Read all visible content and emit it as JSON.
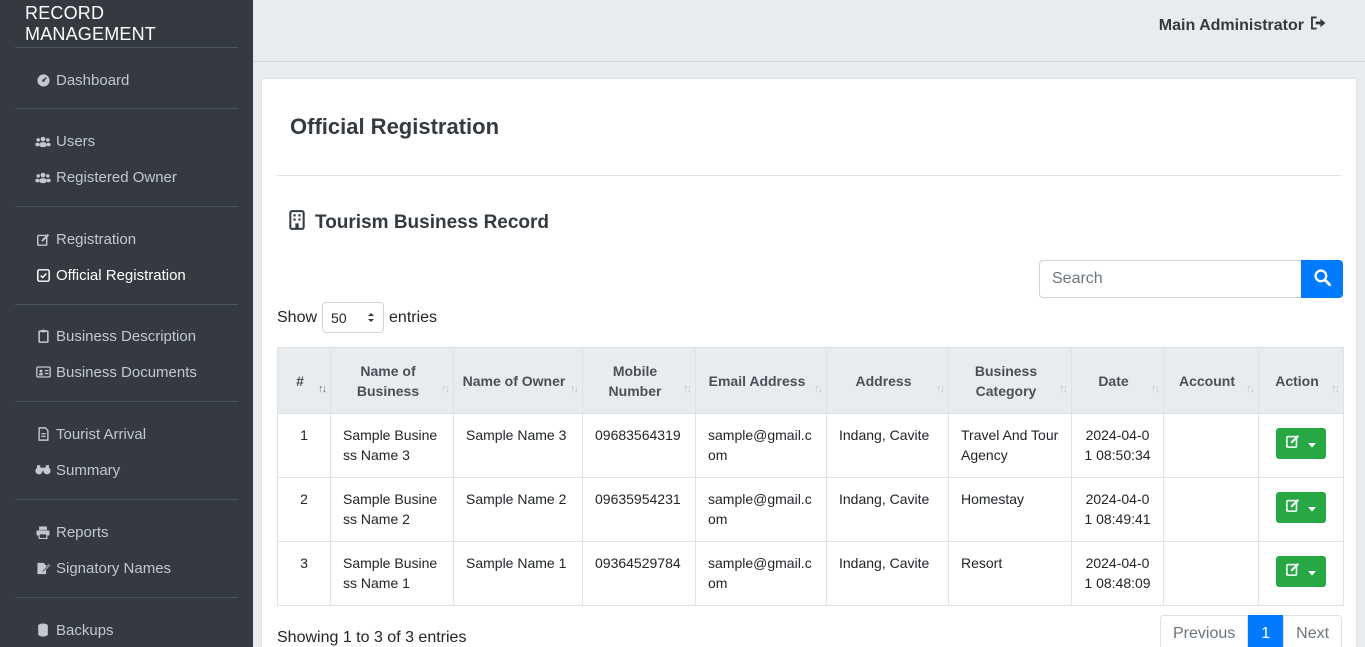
{
  "brand": "RECORD MANAGEMENT",
  "admin": {
    "name": "Main Administrator"
  },
  "nav": {
    "dashboard": "Dashboard",
    "users": "Users",
    "registered_owner": "Registered Owner",
    "registration": "Registration",
    "official_registration": "Official Registration",
    "business_description": "Business Description",
    "business_documents": "Business Documents",
    "tourist_arrival": "Tourist Arrival",
    "summary": "Summary",
    "reports": "Reports",
    "signatory_names": "Signatory Names",
    "backups": "Backups"
  },
  "page": {
    "title": "Official Registration",
    "section_title": "Tourism Business Record"
  },
  "search": {
    "placeholder": "Search"
  },
  "entries": {
    "show": "Show",
    "value": "50",
    "suffix": "entries"
  },
  "table": {
    "headers": {
      "num": "#",
      "business": "Name of Business",
      "owner": "Name of Owner",
      "mobile": "Mobile Number",
      "email": "Email Address",
      "address": "Address",
      "category": "Business Category",
      "date": "Date",
      "account": "Account",
      "action": "Action"
    },
    "rows": [
      {
        "num": "1",
        "business": "Sample Business Name 3",
        "owner": "Sample Name 3",
        "mobile": "09683564319",
        "email": "sample@gmail.com",
        "address": "Indang, Cavite",
        "category": "Travel And Tour Agency",
        "date": "2024-04-01 08:50:34",
        "account": ""
      },
      {
        "num": "2",
        "business": "Sample Business Name 2",
        "owner": "Sample Name 2",
        "mobile": "09635954231",
        "email": "sample@gmail.com",
        "address": "Indang, Cavite",
        "category": "Homestay",
        "date": "2024-04-01 08:49:41",
        "account": ""
      },
      {
        "num": "3",
        "business": "Sample Business Name 1",
        "owner": "Sample Name 1",
        "mobile": "09364529784",
        "email": "sample@gmail.com",
        "address": "Indang, Cavite",
        "category": "Resort",
        "date": "2024-04-01 08:48:09",
        "account": ""
      }
    ]
  },
  "footer": {
    "info": "Showing 1 to 3 of 3 entries",
    "prev": "Previous",
    "page": "1",
    "next": "Next"
  },
  "colors": {
    "sidebar": "#343a40",
    "primary": "#007bff",
    "success": "#28a745"
  }
}
